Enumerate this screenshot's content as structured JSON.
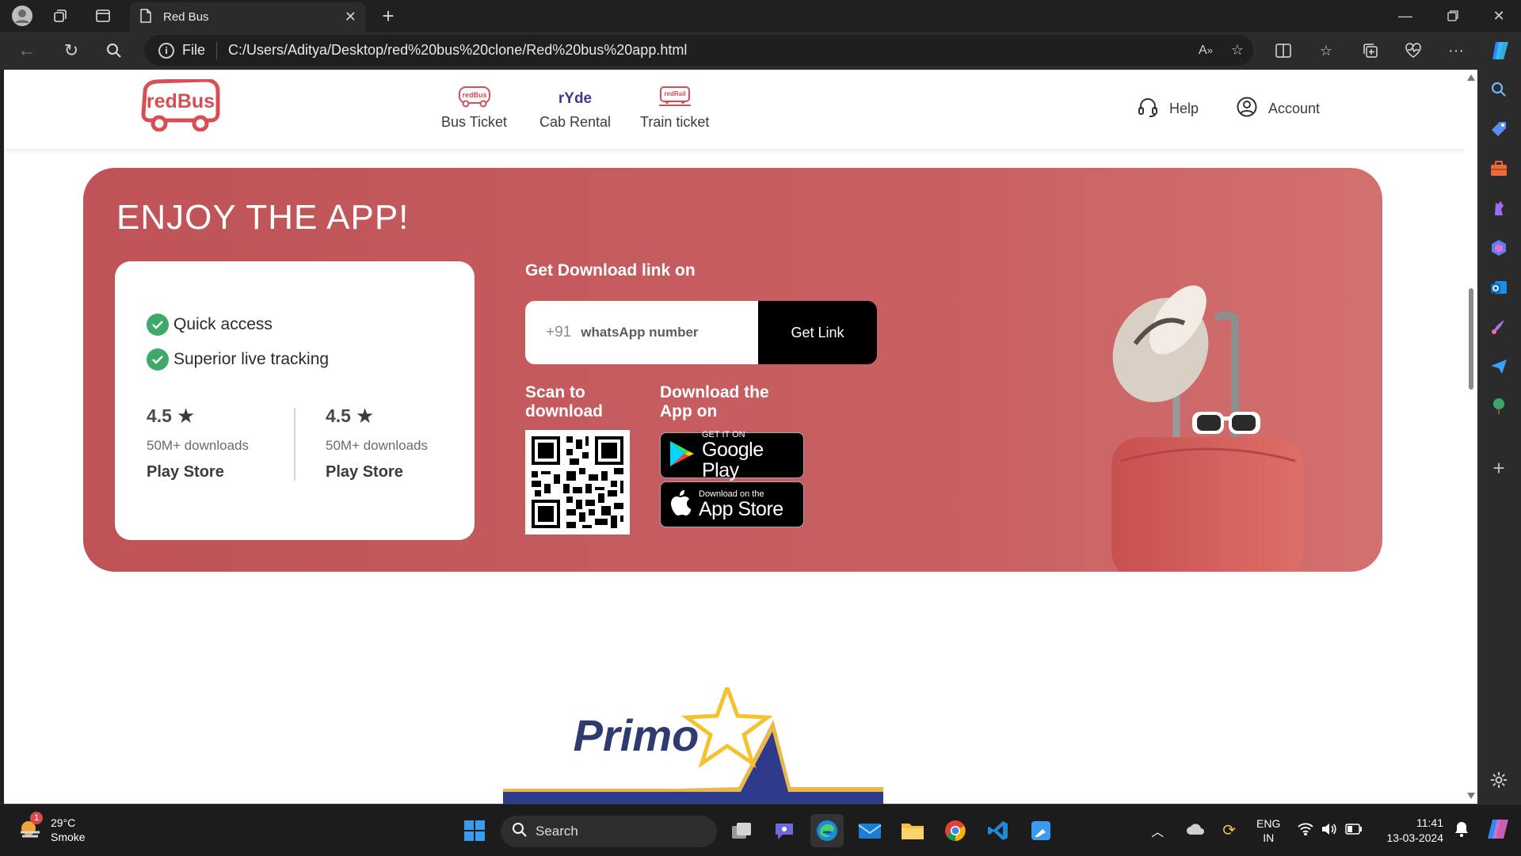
{
  "browser": {
    "tab_title": "Red Bus",
    "address_scheme_label": "File",
    "address_url": "C:/Users/Aditya/Desktop/red%20bus%20clone/Red%20bus%20app.html"
  },
  "site": {
    "brand": "redBus",
    "nav": [
      {
        "label": "Bus Ticket",
        "icon": "redbus-bus-icon",
        "icon_text": "redBus"
      },
      {
        "label": "Cab Rental",
        "icon": "ryde-icon",
        "icon_text": "rYde"
      },
      {
        "label": "Train ticket",
        "icon": "redrail-icon",
        "icon_text": "redRail"
      }
    ],
    "help_label": "Help",
    "account_label": "Account"
  },
  "banner": {
    "title": "ENJOY THE APP!",
    "features": [
      "Quick access",
      "Superior live tracking"
    ],
    "ratings": [
      {
        "score": "4.5",
        "downloads": "50M+ downloads",
        "store": "Play Store"
      },
      {
        "score": "4.5",
        "downloads": "50M+ downloads",
        "store": "Play Store"
      }
    ],
    "download_heading": "Get Download link on",
    "country_code": "+91",
    "phone_placeholder": "whatsApp number",
    "get_link_label": "Get Link",
    "scan_label": "Scan to download",
    "download_app_label": "Download the App on",
    "google_play": {
      "small": "GET IT ON",
      "big": "Google Play"
    },
    "app_store": {
      "small": "Download on the",
      "big": "App Store"
    },
    "colors": {
      "banner": "#c55c5f",
      "check": "#3fa86a"
    }
  },
  "primo": {
    "label": "Primo"
  },
  "taskbar": {
    "weather_temp": "29°C",
    "weather_desc": "Smoke",
    "weather_badge": "1",
    "search_label": "Search",
    "lang_top": "ENG",
    "lang_bottom": "IN",
    "time": "11:41",
    "date": "13-03-2024"
  }
}
